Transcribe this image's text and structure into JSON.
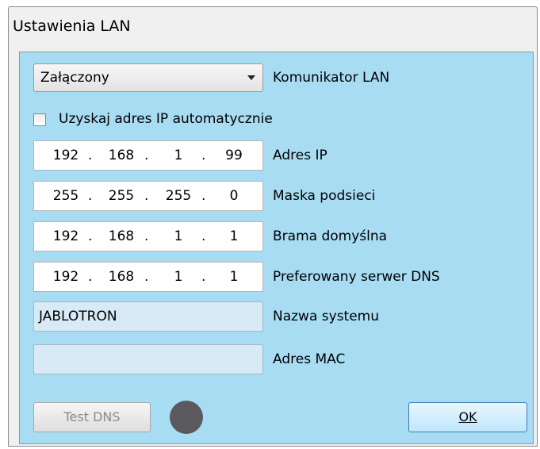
{
  "window": {
    "title": "Ustawienia LAN"
  },
  "lan_mode": {
    "value": "Załączony",
    "label": "Komunikator LAN"
  },
  "dhcp": {
    "label": "Uzyskaj adres IP automatycznie",
    "checked": false
  },
  "ip": {
    "octets": [
      "192",
      "168",
      "1",
      "99"
    ],
    "label": "Adres IP"
  },
  "mask": {
    "octets": [
      "255",
      "255",
      "255",
      "0"
    ],
    "label": "Maska podsieci"
  },
  "gateway": {
    "octets": [
      "192",
      "168",
      "1",
      "1"
    ],
    "label": "Brama domyślna"
  },
  "dns": {
    "octets": [
      "192",
      "168",
      "1",
      "1"
    ],
    "label": "Preferowany serwer DNS"
  },
  "system_name": {
    "value": "JABLOTRON",
    "label": "Nazwa systemu"
  },
  "mac": {
    "value": "",
    "label": "Adres MAC"
  },
  "buttons": {
    "test_dns": "Test DNS",
    "ok": "OK"
  },
  "colors": {
    "panel": "#a7dcf3",
    "status_led": "#5a5a5e"
  },
  "separator": "."
}
